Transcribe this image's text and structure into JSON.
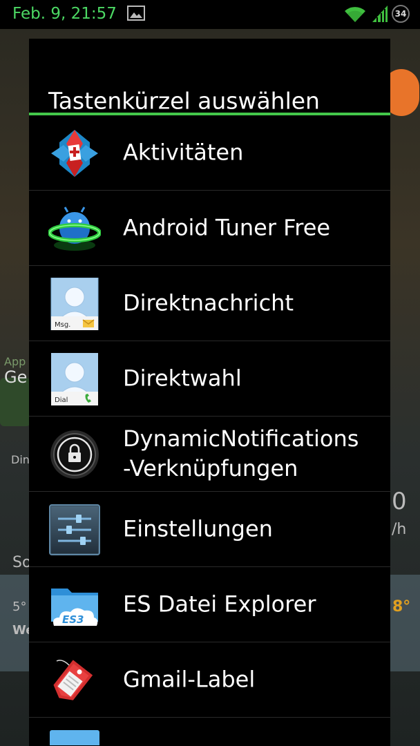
{
  "status_bar": {
    "time": "Feb. 9, 21:57",
    "battery_level": "34",
    "accent_color": "#4cd964",
    "icons": [
      "gallery-notification-icon",
      "wifi-icon",
      "cell-signal-icon",
      "battery-icon"
    ]
  },
  "dialog": {
    "title": "Tastenkürzel auswählen",
    "divider_color": "#44c84a",
    "items": [
      {
        "label": "Aktivitäten",
        "icon": "nova-activities-icon"
      },
      {
        "label": "Android Tuner Free",
        "icon": "android-tuner-icon"
      },
      {
        "label": "Direktnachricht",
        "icon": "direct-message-contact-icon",
        "icon_caption": "Msg."
      },
      {
        "label": "Direktwahl",
        "icon": "direct-dial-contact-icon",
        "icon_caption": "Dial"
      },
      {
        "label": "DynamicNotifications\n-Verknüpfungen",
        "icon": "lock-icon"
      },
      {
        "label": "Einstellungen",
        "icon": "settings-sliders-icon"
      },
      {
        "label": "ES Datei Explorer",
        "icon": "es-file-explorer-icon",
        "icon_caption": "ES3"
      },
      {
        "label": "Gmail-Label",
        "icon": "gmail-label-tag-icon"
      }
    ]
  },
  "background": {
    "widget_texts": [
      "App",
      "Ge",
      "Din",
      "So",
      "5°",
      "We",
      "0",
      "/h",
      "8°"
    ]
  }
}
